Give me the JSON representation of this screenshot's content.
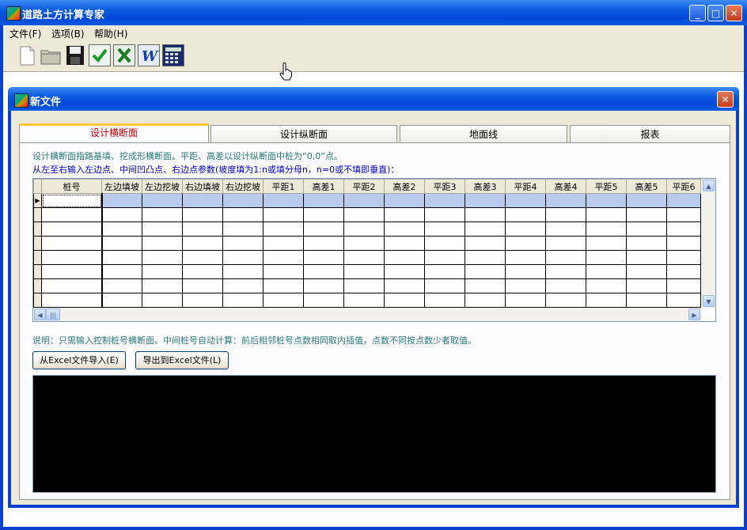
{
  "main_window": {
    "title": "道路土方计算专家",
    "controls": [
      "_",
      "□",
      "✕"
    ]
  },
  "menu": [
    {
      "label": "文件(F)"
    },
    {
      "label": "选项(B)"
    },
    {
      "label": "帮助(H)"
    }
  ],
  "toolbar": {
    "buttons": [
      "new-file",
      "open-folder",
      "save-disk",
      "check",
      "excel",
      "word",
      "calculator"
    ]
  },
  "child_window": {
    "title": "新文件",
    "close": "✕"
  },
  "tabs": [
    {
      "label": "设计横断面",
      "active": true
    },
    {
      "label": "设计纵断面",
      "active": false
    },
    {
      "label": "地面线",
      "active": false
    },
    {
      "label": "报表",
      "active": false
    }
  ],
  "info": {
    "line1": "设计横断面指路基填、挖成形横断面。平距、高差以设计纵断面中桩为“0,0”点。",
    "line2": "从左至右输入左边点、中间凹凸点、右边点参数(坡度填为1:n或填分母n，n=0或不填即垂直)：",
    "note": "说明：只需输入控制桩号横断面。中间桩号自动计算：前后相邻桩号点数相同取内插值，点数不同按点数少者取值。"
  },
  "grid": {
    "columns": [
      "桩号",
      "左边填坡",
      "左边挖坡",
      "右边填坡",
      "右边挖坡",
      "平距1",
      "高差1",
      "平距2",
      "高差2",
      "平距3",
      "高差3",
      "平距4",
      "高差4",
      "平距5",
      "高差5",
      "平距6"
    ],
    "row_count": 8,
    "current_row_marker": "▶"
  },
  "buttons": {
    "import_excel": "从Excel文件导入(E)",
    "export_excel": "导出到Excel文件(L)"
  },
  "colors": {
    "title_bar": "#0a5ae0",
    "selected_row": "#b9cbec",
    "info_text": "#2a7a7a",
    "param_text": "#0000cc",
    "active_tab_text": "#cc0000"
  }
}
